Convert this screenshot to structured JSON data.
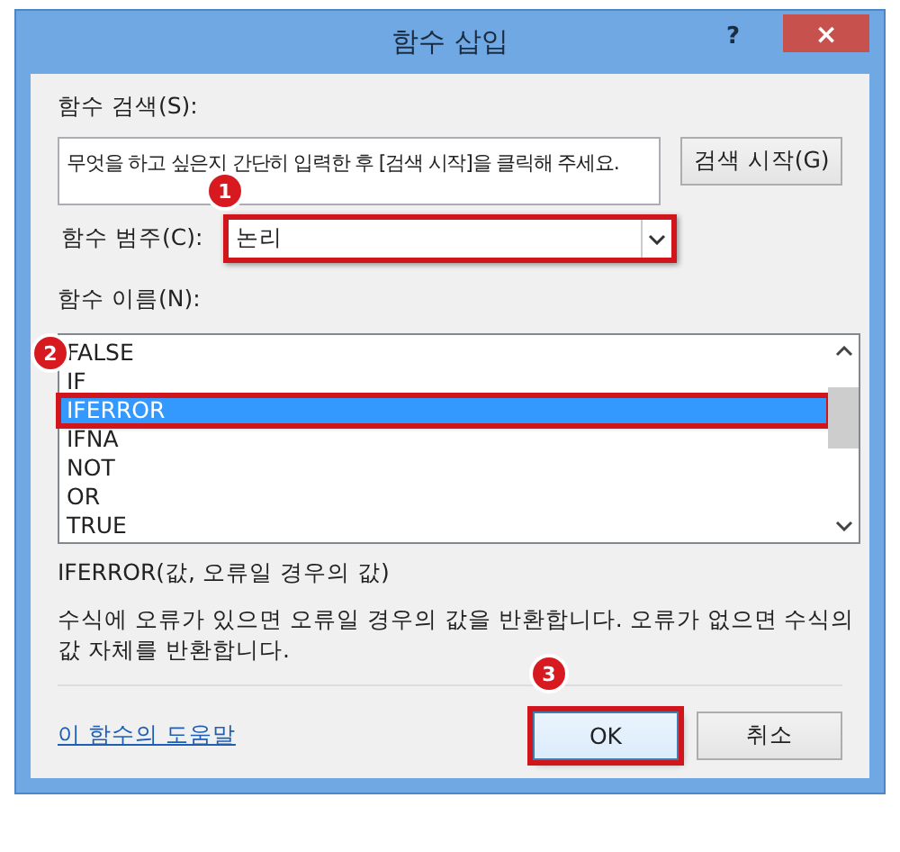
{
  "window": {
    "title": "함수 삽입",
    "help_button": "?",
    "close_button": "×"
  },
  "search": {
    "label": "함수 검색(S):",
    "placeholder": "무엇을 하고 싶은지 간단히 입력한 후 [검색 시작]을 클릭해 주세요.",
    "button": "검색 시작(G)"
  },
  "category": {
    "label": "함수 범주(C):",
    "value": "논리",
    "highlighted": true,
    "badge": "1"
  },
  "functions": {
    "label": "함수 이름(N):",
    "badge": "2",
    "items": [
      {
        "name": "FALSE",
        "selected": false,
        "highlighted": false
      },
      {
        "name": "IF",
        "selected": false,
        "highlighted": false
      },
      {
        "name": "IFERROR",
        "selected": true,
        "highlighted": true
      },
      {
        "name": "IFNA",
        "selected": false,
        "highlighted": false
      },
      {
        "name": "NOT",
        "selected": false,
        "highlighted": false
      },
      {
        "name": "OR",
        "selected": false,
        "highlighted": false
      },
      {
        "name": "TRUE",
        "selected": false,
        "highlighted": false
      }
    ]
  },
  "signature": "IFERROR(값, 오류일 경우의 값)",
  "description": "수식에 오류가 있으면 오류일 경우의 값을 반환합니다. 오류가 없으면 수식의 값 자체를 반환합니다.",
  "help_link": "이 함수의 도움말",
  "buttons": [
    {
      "label": "OK",
      "kind": "primary",
      "highlighted": true,
      "badge": "3"
    },
    {
      "label": "취소",
      "kind": "normal",
      "highlighted": false
    }
  ]
}
